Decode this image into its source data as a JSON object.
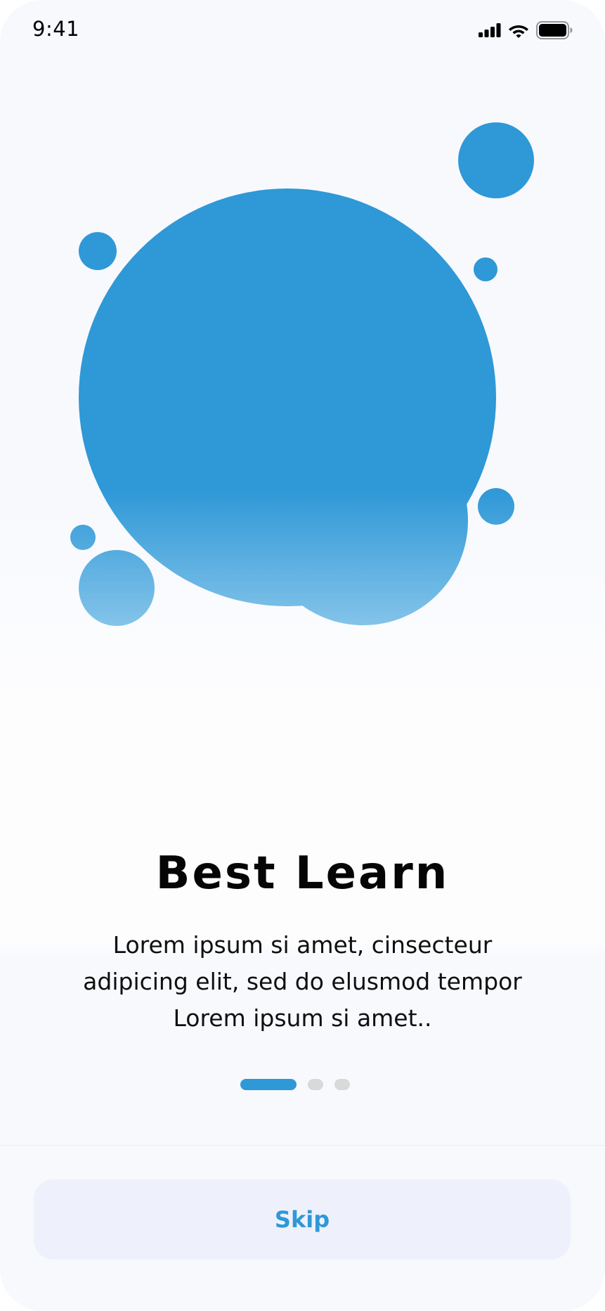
{
  "status_bar": {
    "time": "9:41",
    "icons": [
      "signal-icon",
      "wifi-icon",
      "battery-icon"
    ]
  },
  "onboarding": {
    "title": "Best Learn",
    "description": "Lorem ipsum si amet, cinsecteur adipicing elit, sed do elusmod tempor Lorem ipsum si amet..",
    "pager": {
      "total_pages": 3,
      "active_index": 0
    }
  },
  "footer": {
    "skip_label": "Skip"
  },
  "colors": {
    "accent": "#2f98d7",
    "accent_light": "#85c4ea",
    "pager_inactive": "#d9d9d9",
    "button_background": "#eef1fc",
    "background": "#f7f9fd"
  }
}
